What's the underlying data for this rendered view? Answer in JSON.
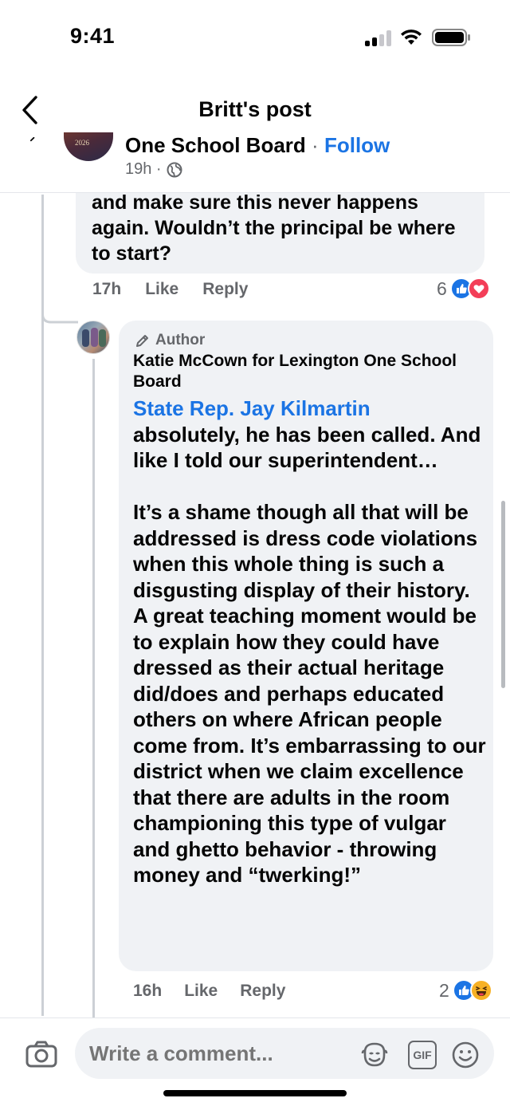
{
  "status_bar": {
    "time": "9:41"
  },
  "nav": {
    "title": "Britt's post"
  },
  "sticky_header": {
    "page_name": "One School Board",
    "separator": "·",
    "follow_label": "Follow",
    "timestamp": "19h ·",
    "avatar_year": "2026"
  },
  "comment1": {
    "text": "and make sure this never happens again.  Wouldn’t the principal be where to start?",
    "time": "17h",
    "like_label": "Like",
    "reply_label": "Reply",
    "reaction_count": "6"
  },
  "reply": {
    "author_tag": "Author",
    "name": "Katie McCown for Lexington One School Board",
    "mention": "State Rep. Jay Kilmartin",
    "text": "absolutely, he has been called. And like I told our superintendent…\n\nIt’s a shame though all that will be addressed is dress code violations when this whole thing is such a disgusting display of their history. A great teaching moment would be to explain how they could have dressed as their actual heritage did/does and perhaps educated others on where African people come from. It’s embarrassing to our district when we claim excellence that there are adults in the room championing this type of vulgar and ghetto behavior - throwing money and “twerking!”",
    "time": "16h",
    "like_label": "Like",
    "reply_label": "Reply",
    "reaction_count": "2"
  },
  "composer": {
    "placeholder": "Write a comment...",
    "gif_label": "GIF"
  },
  "colors": {
    "accent": "#1b74e4",
    "bubble": "#f0f2f5",
    "secondary_text": "#65676b",
    "love": "#f33e58",
    "haha": "#f7b125"
  },
  "icons": [
    "back-chevron-icon",
    "globe-icon",
    "pencil-icon",
    "like-reaction-icon",
    "love-reaction-icon",
    "haha-reaction-icon",
    "camera-icon",
    "avatar-sticker-icon",
    "gif-icon",
    "emoji-icon"
  ]
}
